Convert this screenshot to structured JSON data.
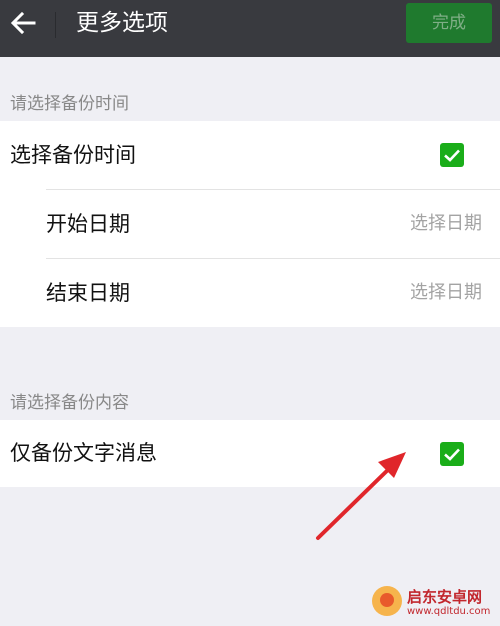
{
  "header": {
    "title": "更多选项",
    "done_label": "完成"
  },
  "time_section": {
    "label": "请选择备份时间",
    "select_time_label": "选择备份时间",
    "select_time_checked": true,
    "rows": [
      {
        "label": "开始日期",
        "value": "选择日期"
      },
      {
        "label": "结束日期",
        "value": "选择日期"
      }
    ]
  },
  "content_section": {
    "label": "请选择备份内容",
    "text_only_label": "仅备份文字消息",
    "text_only_checked": true
  },
  "colors": {
    "topbar": "#393a3f",
    "check": "#1aad19",
    "done_button": "#1f7a2e",
    "annotation_arrow": "#e0262b"
  },
  "watermark": {
    "brand": "启东安卓网",
    "url": "www.qdltdu.com"
  }
}
